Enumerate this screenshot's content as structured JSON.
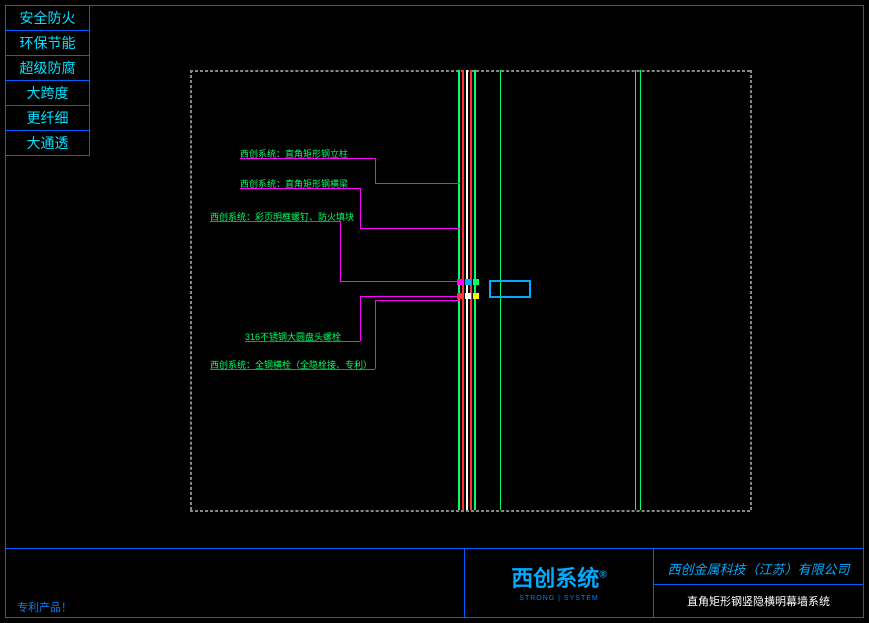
{
  "sidebar": {
    "items": [
      "安全防火",
      "环保节能",
      "超级防腐",
      "大跨度",
      "更纤细",
      "大通透"
    ]
  },
  "labels": {
    "l1": "西创系统：直角矩形钢立柱",
    "l2": "西创系统：直角矩形钢横梁",
    "l3": "西创系统：彩页明框螺钉、防火填块",
    "l4": "316不锈钢大圆盘头螺栓",
    "l5": "西创系统：全钢横栓（全隐栓接、专利）"
  },
  "footer": {
    "patent": "专利产品！",
    "brand": "西创系统",
    "brand_sup": "®",
    "brand_sub": "STRONG | SYSTEM",
    "company": "西创金属科技（江苏）有限公司",
    "subtitle": "直角矩形钢竖隐横明幕墙系统"
  }
}
